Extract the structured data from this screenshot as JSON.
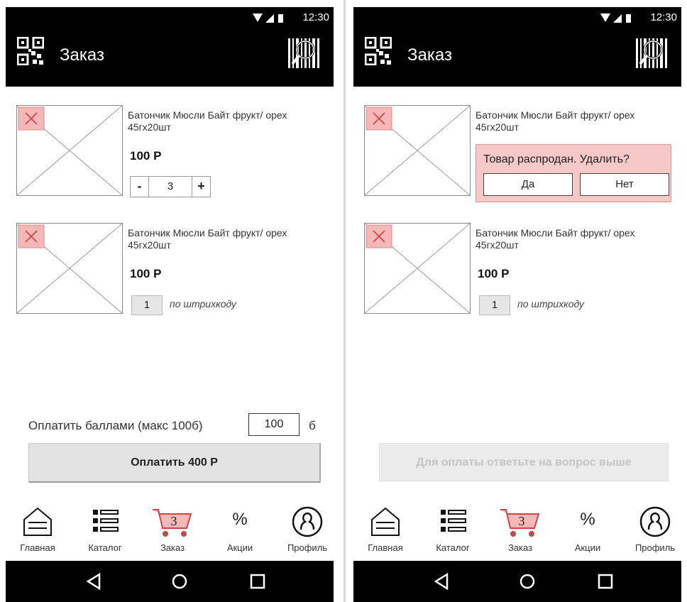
{
  "status": {
    "time": "12:30"
  },
  "header": {
    "title": "Заказ"
  },
  "products": [
    {
      "name": "Батончик Мюсли Байт фрукт/ орех 45гх20шт",
      "price": "100 Р",
      "quantity": "3",
      "minus": "-",
      "plus": "+"
    },
    {
      "name": "Батончик Мюсли Байт фрукт/ орех 45гх20шт",
      "price": "100 Р",
      "quantity": "1",
      "note": "по штрихкоду"
    }
  ],
  "soldout_dialog": {
    "message": "Товар распродан. Удалить?",
    "yes": "Да",
    "no": "Нет"
  },
  "points": {
    "label": "Оплатить баллами (макс 100б)",
    "value": "100",
    "unit": "б"
  },
  "pay_button": {
    "label": "Оплатить 400 Р",
    "disabled_label": "Для оплаты ответьте на вопрос выше"
  },
  "tabs": [
    {
      "label": "Главная",
      "icon": "home-icon"
    },
    {
      "label": "Каталог",
      "icon": "list-icon"
    },
    {
      "label": "Заказ",
      "icon": "cart-icon",
      "badge": "3",
      "active": true
    },
    {
      "label": "Акции",
      "icon": "percent-icon",
      "glyph": "%"
    },
    {
      "label": "Профиль",
      "icon": "profile-icon"
    }
  ],
  "colors": {
    "bar": "#000000",
    "dialog_bg": "#f6c9c9",
    "placeholder_x": "#f4b8b8",
    "disabled_text": "#c4c4c4"
  }
}
